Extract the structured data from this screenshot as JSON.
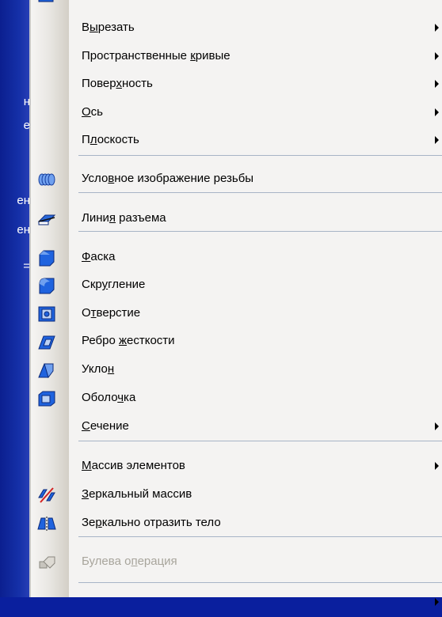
{
  "background_fragments": [
    "н",
    "е",
    "ен",
    "ен",
    "="
  ],
  "colors": {
    "desktop_blue": "#0a1f9e",
    "menu_bg": "#f4f3f2",
    "separator": "#a7b4c6",
    "disabled_text": "#a8a59c",
    "icon_blue": "#1c5fd6"
  },
  "menu": {
    "items": [
      {
        "pre": "В",
        "ul": "ы",
        "post": "резать",
        "submenu": true,
        "icon": ""
      },
      {
        "pre": "Пространственные ",
        "ul": "к",
        "post": "ривые",
        "submenu": true,
        "icon": ""
      },
      {
        "pre": "Повер",
        "ul": "х",
        "post": "ность",
        "submenu": true,
        "icon": ""
      },
      {
        "pre": "",
        "ul": "О",
        "post": "сь",
        "submenu": true,
        "icon": ""
      },
      {
        "pre": "П",
        "ul": "л",
        "post": "оскость",
        "submenu": true,
        "icon": ""
      },
      {
        "pre": "Усло",
        "ul": "в",
        "post": "ное изображение резьбы",
        "submenu": false,
        "icon": "thread-icon"
      },
      {
        "pre": "Лини",
        "ul": "я",
        "post": " разъема",
        "submenu": false,
        "icon": "parting-line-icon"
      },
      {
        "pre": "",
        "ul": "Ф",
        "post": "аска",
        "submenu": false,
        "icon": "chamfer-icon"
      },
      {
        "pre": "Скр",
        "ul": "у",
        "post": "гление",
        "submenu": false,
        "icon": "fillet-icon"
      },
      {
        "pre": "О",
        "ul": "т",
        "post": "верстие",
        "submenu": false,
        "icon": "hole-icon"
      },
      {
        "pre": "Ребро ",
        "ul": "ж",
        "post": "есткости",
        "submenu": false,
        "icon": "rib-icon"
      },
      {
        "pre": "Укло",
        "ul": "н",
        "post": "",
        "submenu": false,
        "icon": "draft-icon"
      },
      {
        "pre": "Оболо",
        "ul": "ч",
        "post": "ка",
        "submenu": false,
        "icon": "shell-icon"
      },
      {
        "pre": "",
        "ul": "С",
        "post": "ечение",
        "submenu": true,
        "icon": ""
      },
      {
        "pre": "",
        "ul": "М",
        "post": "ассив элементов",
        "submenu": true,
        "icon": ""
      },
      {
        "pre": "",
        "ul": "З",
        "post": "еркальный массив",
        "submenu": false,
        "icon": "mirror-array-icon"
      },
      {
        "pre": "Зе",
        "ul": "р",
        "post": "кально отразить тело",
        "submenu": false,
        "icon": "mirror-body-icon"
      },
      {
        "pre": "Булева о",
        "ul": "п",
        "post": "ерация",
        "submenu": false,
        "icon": "boolean-icon",
        "disabled": true
      }
    ]
  }
}
